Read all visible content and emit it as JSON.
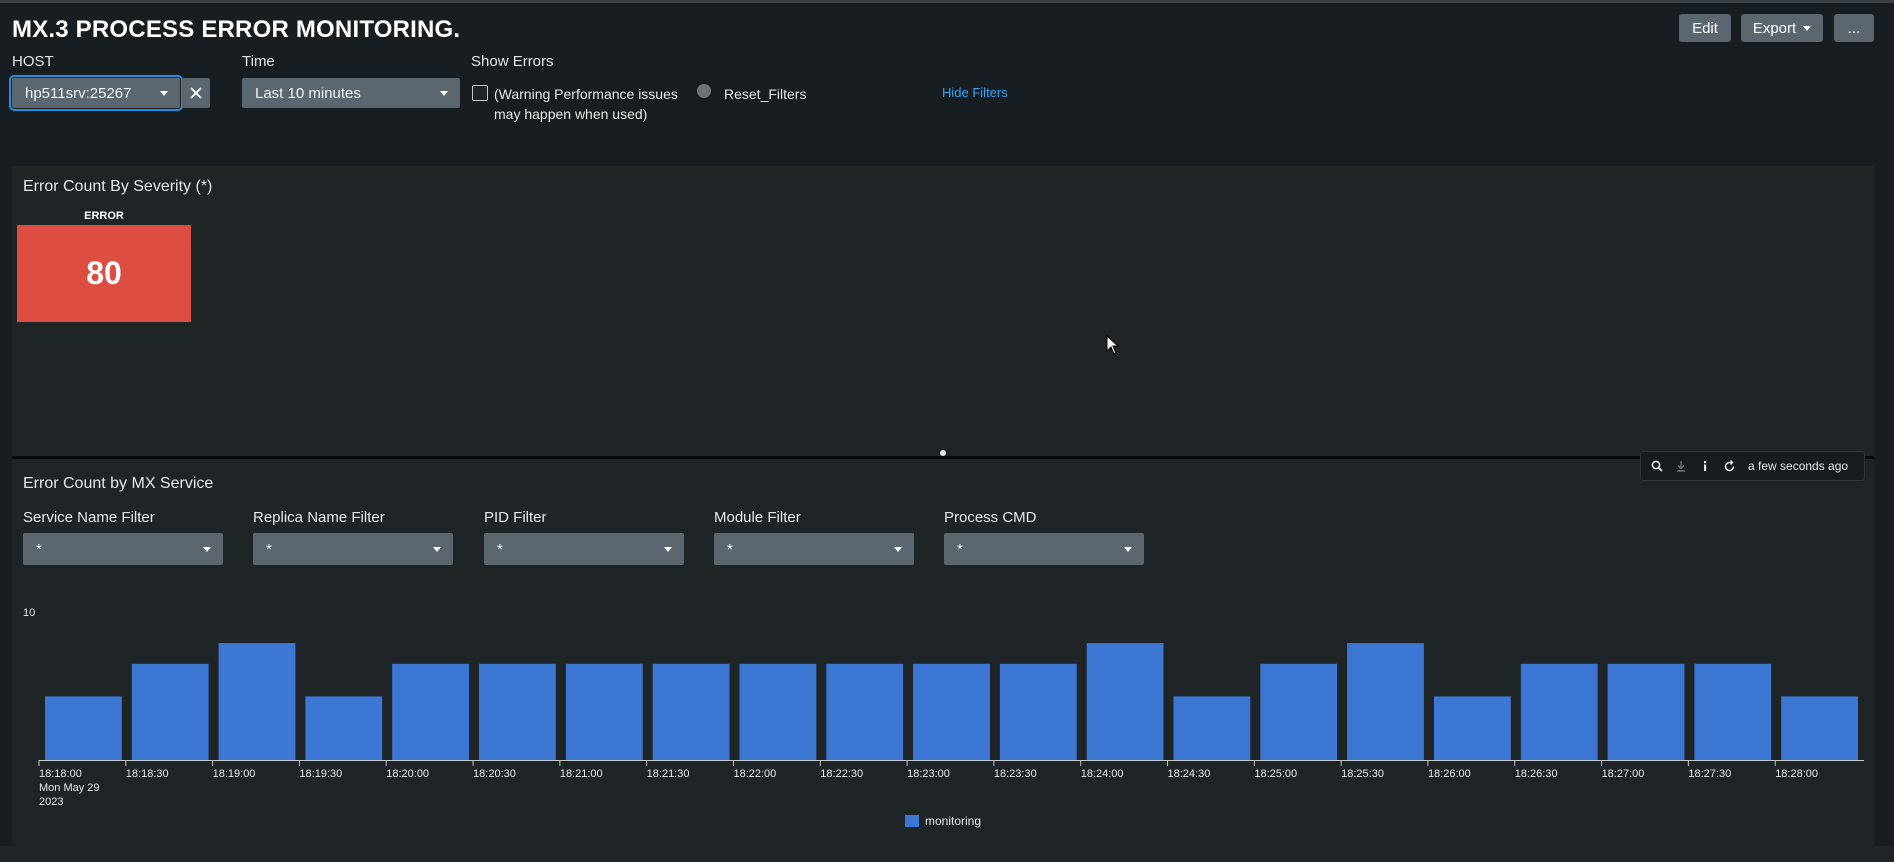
{
  "header": {
    "title": "MX.3 PROCESS ERROR MONITORING.",
    "edit_label": "Edit",
    "export_label": "Export",
    "more_label": "..."
  },
  "filters": {
    "host_label": "HOST",
    "host_value": "hp511srv:25267",
    "time_label": "Time",
    "time_value": "Last 10 minutes",
    "show_errors_label": "Show Errors",
    "show_errors_option_line1": "(Warning Performance issues",
    "show_errors_option_line2": "may happen when used)",
    "reset_label": "Reset_Filters",
    "hide_filters_label": "Hide Filters"
  },
  "severity_panel": {
    "title": "Error Count By Severity (*)",
    "severity_name": "ERROR",
    "severity_value": "80",
    "severity_color": "#dc4e41"
  },
  "toolbar": {
    "icons": [
      "search-icon",
      "download-icon",
      "info-icon",
      "refresh-icon"
    ],
    "timestamp": "a few seconds ago"
  },
  "service_panel": {
    "title": "Error Count by MX Service",
    "filters": [
      {
        "label": "Service Name Filter",
        "value": "*"
      },
      {
        "label": "Replica Name Filter",
        "value": "*"
      },
      {
        "label": "PID Filter",
        "value": "*"
      },
      {
        "label": "Module Filter",
        "value": "*"
      },
      {
        "label": "Process CMD",
        "value": "*"
      }
    ]
  },
  "chart_data": {
    "type": "bar",
    "categories": [
      "18:18:00",
      "18:18:30",
      "18:19:00",
      "18:19:30",
      "18:20:00",
      "18:20:30",
      "18:21:00",
      "18:21:30",
      "18:22:00",
      "18:22:30",
      "18:23:00",
      "18:23:30",
      "18:24:00",
      "18:24:30",
      "18:25:00",
      "18:25:30",
      "18:26:00",
      "18:26:30",
      "18:27:00",
      "18:27:30",
      "18:28:00"
    ],
    "first_tick_date_line1": "Mon May 29",
    "first_tick_date_line2": "2023",
    "series": [
      {
        "name": "monitoring",
        "values": [
          4.3,
          6.5,
          7.9,
          4.3,
          6.5,
          6.5,
          6.5,
          6.5,
          6.5,
          6.5,
          6.5,
          6.5,
          7.9,
          4.3,
          6.5,
          7.9,
          4.3,
          6.5,
          6.5,
          6.5,
          4.3
        ],
        "color": "#3c78d3"
      }
    ],
    "ytick_label": "10",
    "ylim": [
      0,
      10
    ],
    "legend_position": "bottom",
    "grid": false
  }
}
